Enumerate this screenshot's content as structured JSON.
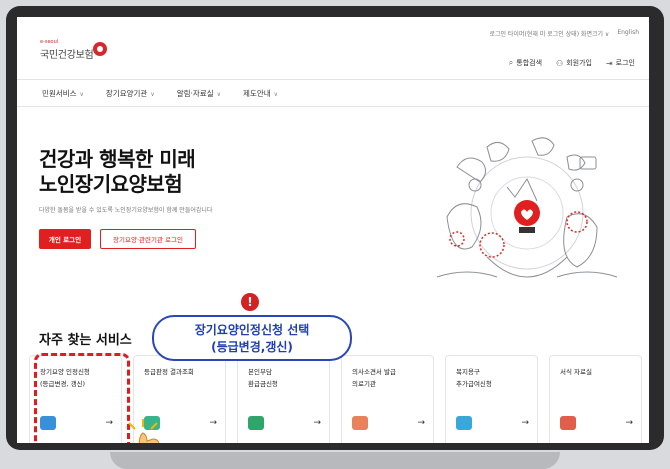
{
  "utility": {
    "items": [
      "로그인 타이머(현재 미 로그인 상태) 화면크기 ∨",
      "English"
    ]
  },
  "logo": {
    "small": "e-seoul",
    "name": "국민건강보험"
  },
  "header": {
    "actions": [
      {
        "icon": "search-icon",
        "label": "통합검색"
      },
      {
        "icon": "user-plus-icon",
        "label": "회원가입"
      },
      {
        "icon": "login-icon",
        "label": "로그인"
      }
    ]
  },
  "nav": {
    "items": [
      "민원서비스",
      "장기요양기관",
      "알림·자료실",
      "제도안내"
    ]
  },
  "hero": {
    "title_line1": "건강과 행복한 미래",
    "title_line2": "노인장기요양보험",
    "subtitle": "다양한 돌봄을 받을 수 있도록 노인장기요양보험이 함께 만들어갑니다",
    "primary_button": "개인 로그인",
    "secondary_button": "장기요양·관련기관 로그인"
  },
  "section": {
    "title": "자주 찾는 서비스"
  },
  "callout": {
    "line1": "장기요양인정신청 선택",
    "line2": "(등급변경,갱신)"
  },
  "alert": {
    "symbol": "!"
  },
  "cards": [
    {
      "label": "장기요양 인정신청\n(등급변경, 갱신)",
      "icon": "document-edit-icon",
      "color": "#3a8fd9"
    },
    {
      "label": "등급판정 결과조회",
      "icon": "document-check-icon",
      "color": "#38b48b"
    },
    {
      "label": "본인부담\n환급금신청",
      "icon": "money-icon",
      "color": "#2fa56b"
    },
    {
      "label": "의사소견서 발급\n의료기관",
      "icon": "medical-kit-icon",
      "color": "#e9825a"
    },
    {
      "label": "복지용구\n추가급여신청",
      "icon": "bed-icon",
      "color": "#3aa7d9"
    },
    {
      "label": "서식 자료실",
      "icon": "folder-icon",
      "color": "#e05e4a"
    }
  ],
  "colors": {
    "accent": "#e02020",
    "callout": "#2a46b8"
  }
}
